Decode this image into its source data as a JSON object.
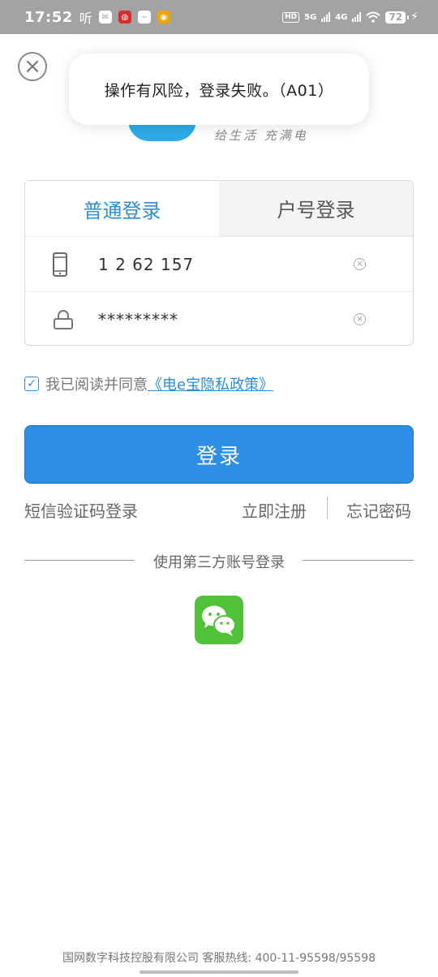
{
  "status_bar": {
    "time": "17:52",
    "ting_label": "听",
    "hd_label": "HD",
    "net_5g": "5G",
    "net_4g": "4G",
    "battery_level": "72"
  },
  "toast": {
    "message": "操作有风险，登录失败。（A01）"
  },
  "brand": {
    "slogan": "给生活 充满电"
  },
  "tabs": {
    "normal_login": "普通登录",
    "account_login": "户号登录"
  },
  "form": {
    "phone_value": "1 2 62 157",
    "password_value": "*********"
  },
  "agreement": {
    "text": "我已阅读并同意",
    "link": "《电e宝隐私政策》",
    "checked": true
  },
  "buttons": {
    "login": "登录"
  },
  "links": {
    "sms_login": "短信验证码登录",
    "register": "立即注册",
    "forgot_password": "忘记密码"
  },
  "third_party": {
    "label": "使用第三方账号登录"
  },
  "footer": {
    "text": "国网数字科技控股有限公司  客服热线: 400-11-95598/95598"
  },
  "colors": {
    "accent": "#2d8ee6",
    "link": "#2a8fd6",
    "wechat": "#52c13a",
    "status_bar": "#a3a3a3"
  }
}
